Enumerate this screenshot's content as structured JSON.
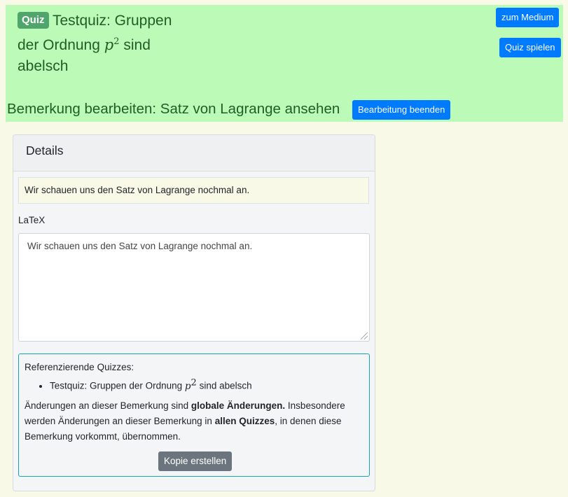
{
  "header": {
    "badge": "Quiz",
    "title_part1": "Testquiz: Gruppen der Ordnung",
    "title_math": "p",
    "title_exp": "2",
    "title_part2": "sind abelsch",
    "btn_medium": "zum Medium",
    "btn_play": "Quiz spielen",
    "edit_text": "Bemerkung bearbeiten: Satz von Lagrange ansehen",
    "btn_end": "Bearbeitung beenden"
  },
  "card": {
    "title": "Details",
    "preview_text": "Wir schauen uns den Satz von Lagrange nochmal an.",
    "latex_label": "LaTeX",
    "latex_value": "Wir schauen uns den Satz von Lagrange nochmal an.",
    "ref_heading": "Referenzierende Quizzes:",
    "ref_items": [
      {
        "part1": "Testquiz: Gruppen der Ordnung",
        "math": "p",
        "exp": "2",
        "part2": "sind abelsch"
      }
    ],
    "note": {
      "t1": "Änderungen an dieser Bemerkung sind ",
      "b1": "globale Änderungen.",
      "t2": " Insbesondere werden Änderungen an dieser Bemerkung in ",
      "b2": "allen Quizzes",
      "t3": ", in denen diese Bemerkung vorkommt, übernommen."
    },
    "copy_button": "Kopie erstellen"
  },
  "colors": {
    "header_bg": "#bbfbb7",
    "header_text": "#1e5f25",
    "badge_bg": "#4fa56c",
    "primary_button": "#007bff",
    "secondary_button": "#6c757d",
    "page_bg": "#f8f9e6",
    "ref_border": "#17a2b8"
  }
}
